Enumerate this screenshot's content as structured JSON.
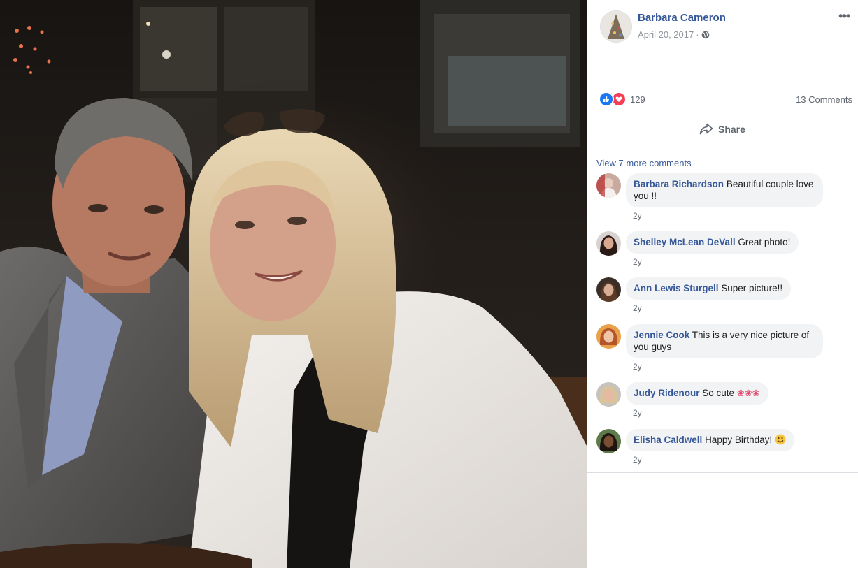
{
  "post": {
    "author": "Barbara Cameron",
    "date": "April 20, 2017",
    "date_separator": "·",
    "more_label": "•••",
    "reaction_count": "129",
    "comments_count": "13 Comments",
    "share_label": "Share"
  },
  "comments_section": {
    "view_more": "View 7 more comments",
    "items": [
      {
        "name": "Barbara Richardson",
        "text": "Beautiful couple love you !!",
        "time": "2y"
      },
      {
        "name": "Shelley McLean DeVall",
        "text": "Great photo!",
        "time": "2y"
      },
      {
        "name": "Ann Lewis Sturgell",
        "text": "Super picture!!",
        "time": "2y"
      },
      {
        "name": "Jennie Cook",
        "text": "This is a very nice picture of you guys",
        "time": "2y"
      },
      {
        "name": "Judy Ridenour",
        "text": "So cute",
        "emoji": "❀❀❀",
        "time": "2y"
      },
      {
        "name": "Elisha Caldwell",
        "text": "Happy Birthday!",
        "time": "2y"
      }
    ]
  },
  "colors": {
    "link": "#365899",
    "secondary_text": "#606770",
    "bubble_bg": "#f2f3f5",
    "like_blue": "#1877f2",
    "love_red": "#f33e58"
  },
  "icons": [
    "globe-icon",
    "like-reaction-icon",
    "love-reaction-icon",
    "share-arrow-icon",
    "more-options-icon",
    "smile-emoji-icon"
  ]
}
